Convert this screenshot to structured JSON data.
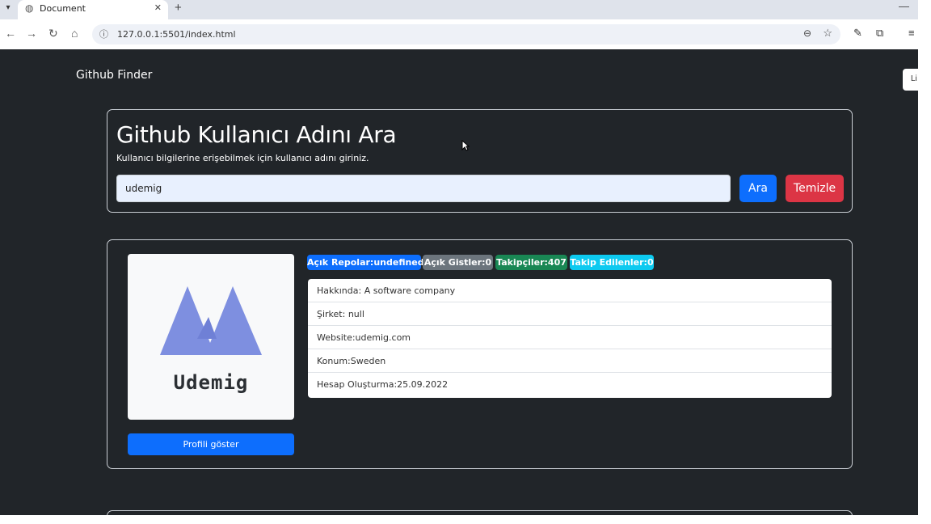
{
  "browser": {
    "tab_title": "Document",
    "url": "127.0.0.1:5501/index.html"
  },
  "navbar": {
    "brand": "Github Finder",
    "side_pill": "Li"
  },
  "search": {
    "title": "Github Kullanıcı Adını Ara",
    "subtitle": "Kullanıcı bilgilerine erişebilmek için kullanıcı adını giriniz.",
    "input_value": "udemig",
    "search_label": "Ara",
    "clear_label": "Temizle"
  },
  "profile": {
    "avatar_text": "Udemig",
    "show_profile_label": "Profili göster",
    "badges": {
      "repos": "Açık Repolar:undefined",
      "gists": "Açık Gistler:0",
      "followers": "Takipçiler:407",
      "following": "Takip Edilenler:0"
    },
    "info": [
      "Hakkında: A software company",
      "Şirket: null",
      "Website:udemig.com",
      "Konum:Sweden",
      "Hesap Oluşturma:25.09.2022"
    ]
  },
  "colors": {
    "page_bg": "#212529",
    "primary": "#0d6efd",
    "danger": "#dc3545",
    "secondary": "#6c757d",
    "success": "#198754",
    "info": "#0dcaf0",
    "logo": "#7e8fe0"
  }
}
